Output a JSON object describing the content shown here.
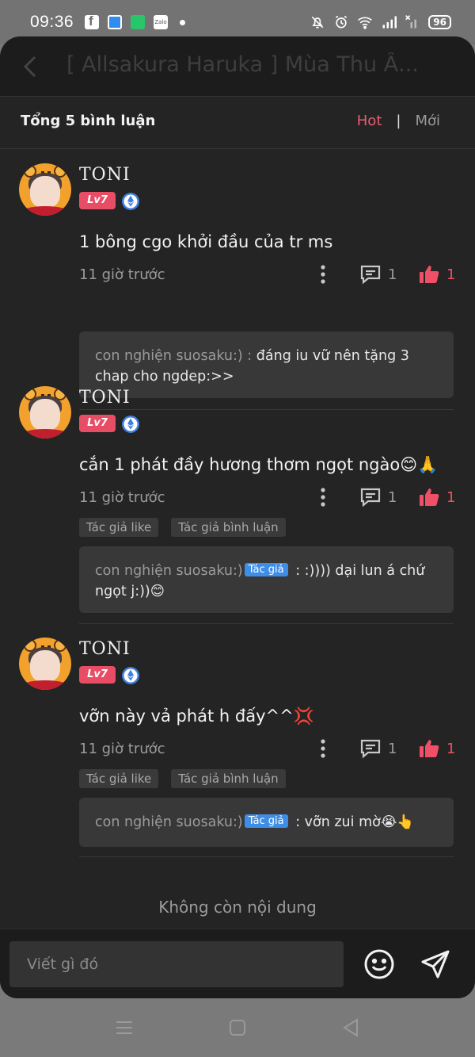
{
  "status_bar": {
    "time": "09:36",
    "battery": "96",
    "icons": [
      "facebook-icon",
      "notes-icon",
      "green-app-icon",
      "zalo-icon",
      "notification-dot",
      "bell-off-icon",
      "alarm-icon",
      "wifi-icon",
      "signal-icon",
      "signal-x-icon",
      "battery-icon"
    ]
  },
  "header": {
    "title": "[ Allsakura Haruka ] Mùa Thu Ấ..."
  },
  "comments_header": {
    "total": "Tổng 5 bình luận",
    "sort_hot": "Hot",
    "sort_separator": "|",
    "sort_new": "Mới"
  },
  "comments": [
    {
      "user": "TONI",
      "level": "Lv7",
      "text": "1 bông cgo khởi đầu của tr ms",
      "time": "11 giờ trước",
      "reply_count": "1",
      "like_count": "1",
      "tags": [],
      "reply": {
        "author": "con nghiện suosaku:) :",
        "is_author": false,
        "author_tag": "",
        "text": "đáng iu vữ nên tặng 3 chap cho ngdep:>>"
      }
    },
    {
      "user": "TONI",
      "level": "Lv7",
      "text": "cắn 1 phát đầy hương thơm ngọt ngào😊🙏",
      "time": "11 giờ trước",
      "reply_count": "1",
      "like_count": "1",
      "tags": [
        "Tác giả like",
        "Tác giả bình luận"
      ],
      "reply": {
        "author": "con nghiện suosaku:)",
        "is_author": true,
        "author_tag": "Tác giả",
        "text": ": :)))) dại lun á chứ ngọt j:))😊"
      }
    },
    {
      "user": "TONI",
      "level": "Lv7",
      "text": "vỡn này vả phát h đấy^^💢",
      "time": "11 giờ trước",
      "reply_count": "1",
      "like_count": "1",
      "tags": [
        "Tác giả like",
        "Tác giả bình luận"
      ],
      "reply": {
        "author": "con nghiện suosaku:)",
        "is_author": true,
        "author_tag": "Tác giả",
        "text": ": vỡn zui mờ😭👆"
      }
    }
  ],
  "footer": {
    "no_more": "Không còn nội dung"
  },
  "input": {
    "placeholder": "Viết gì đó"
  },
  "colors": {
    "accent_pink": "#ef5068",
    "author_tag_blue": "#3f8ee6",
    "panel_bg": "#242424",
    "reply_bg": "#383838"
  }
}
